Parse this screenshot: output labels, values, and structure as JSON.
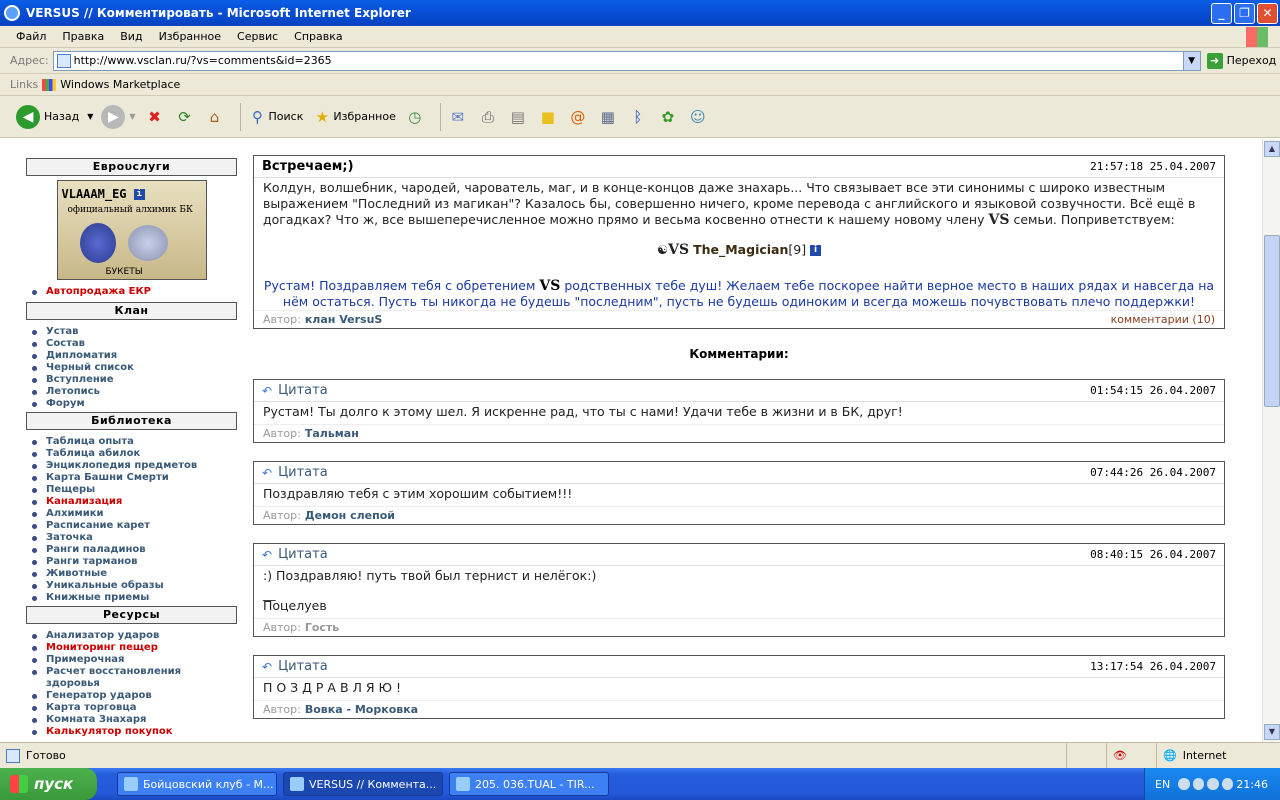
{
  "window": {
    "title": "VERSUS // Комментировать - Microsoft Internet Explorer"
  },
  "menu": [
    "Файл",
    "Правка",
    "Вид",
    "Избранное",
    "Сервис",
    "Справка"
  ],
  "address": {
    "label": "Адрес:",
    "url": "http://www.vsclan.ru/?vs=comments&id=2365",
    "go": "Переход"
  },
  "links": {
    "label": "Links",
    "item": "Windows Marketplace"
  },
  "toolbar": {
    "back": "Назад",
    "search": "Поиск",
    "favorites": "Избранное"
  },
  "sidebar": {
    "euro": {
      "title": "Еврουслуги",
      "banner_name": "VLAAAM_EG",
      "banner_sub": "официальный алхимик БК",
      "banner_bottom": "БУКЕТЫ",
      "items": [
        "Автопродажа ЕКР"
      ]
    },
    "clan": {
      "title": "Клан",
      "items": [
        "Устав",
        "Состав",
        "Дипломатия",
        "Черный список",
        "Вступление",
        "Летопись",
        "Форум"
      ]
    },
    "library": {
      "title": "Библиотека",
      "items": [
        "Таблица опыта",
        "Таблица абилок",
        "Энциклопедия предметов",
        "Карта Башни Смерти",
        "Пещеры",
        "Канализация",
        "Алхимики",
        "Расписание карет",
        "Заточка",
        "Ранги паладинов",
        "Ранги тарманов",
        "Животные",
        "Уникальные образы",
        "Книжные приемы"
      ]
    },
    "resources": {
      "title": "Ресурсы",
      "items": [
        "Анализатор ударов",
        "Мониторинг пещер",
        "Примерочная",
        "Расчет восстановления",
        "здоровья",
        "Генератор ударов",
        "Карта торговца",
        "Комната Знахаря",
        "Калькулятор покупок"
      ]
    }
  },
  "post": {
    "title": "Встречаем;)",
    "date": "21:57:18 25.04.2007",
    "text1": "Колдун, волшебник, чародей, чарователь, маг, и в конце-концов даже знахарь... Что связывает все эти синонимы с широко известным выражением \"Последний из магикан\"? Казалось бы, совершенно ничего, кроме перевода с английского и языковой созвучности. Всё ещё в догадках? Что ж, все вышеперечисленное можно прямо и весьма косвенно отнести к нашему новому члену",
    "text1b": "семьи. Поприветствуем:",
    "vs": "VS",
    "magician": "The_Magician",
    "level": "[9]",
    "text2a": "Рустам! Поздравляем тебя с обретением",
    "text2b": "родственных тебе душ! Желаем тебе поскорее найти верное место в наших рядах и навсегда на нём остаться. Пусть ты никогда не будешь \"последним\", пусть не будешь одиноким и всегда можешь почувствовать плечо поддержки!",
    "author_label": "Автор:",
    "author": "клан VersuS",
    "comments": "комментарии (10)"
  },
  "comments_title": "Комментарии:",
  "comments": [
    {
      "quote": "Цитата",
      "date": "01:54:15 26.04.2007",
      "text": "Рустам! Ты долго к этому шел. Я искренне рад, что ты с нами! Удачи тебе в жизни и в БК, друг!",
      "author": "Тальман"
    },
    {
      "quote": "Цитата",
      "date": "07:44:26 26.04.2007",
      "text": "Поздравляю тебя с этим хорошим событием!!!",
      "author": "Демон слепой"
    },
    {
      "quote": "Цитата",
      "date": "08:40:15 26.04.2007",
      "text": ":) Поздравляю! путь твой был тернист и нелёгок:)",
      "sig1": "__",
      "sig2": "Поцелуев",
      "author": "Гость"
    },
    {
      "quote": "Цитата",
      "date": "13:17:54 26.04.2007",
      "text": "П О З Д Р А В Л Я Ю !",
      "author": "Вовка - Морковка"
    }
  ],
  "status": {
    "text": "Готово",
    "zone": "Internet"
  },
  "taskbar": {
    "start": "пуск",
    "tasks": [
      "Бойцовский клуб - М...",
      "VERSUS // Коммента...",
      "205. 036.TUAL - TIR..."
    ],
    "lang": "EN",
    "clock": "21:46"
  }
}
